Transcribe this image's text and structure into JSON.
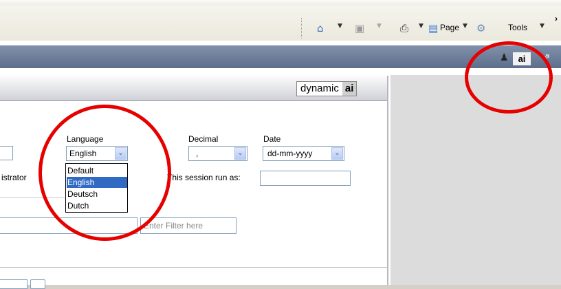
{
  "toolbar": {
    "page_label": "Page",
    "tools_label": "Tools",
    "home_icon": "home-icon",
    "feeds_icon": "feeds-icon",
    "print_icon": "print-icon",
    "page_icon": "page-icon",
    "tools_icon": "gear-icon"
  },
  "appbar": {
    "user_icon": "user-icon",
    "ai_badge": "ai",
    "collapse_icon": "collapse-icon"
  },
  "panel": {
    "logo_text": "dynamic",
    "logo_ai": "ai"
  },
  "form": {
    "language_label": "Language",
    "language_value": "English",
    "language_options": [
      "Default",
      "English",
      "Deutsch",
      "Dutch"
    ],
    "language_selected_index": 1,
    "decimal_label": "Decimal",
    "decimal_value": ",",
    "date_label": "Date",
    "date_value": "dd-mm-yyyy",
    "user_partial": "istrator",
    "session_label": "This session run as:",
    "session_value": "",
    "filter_placeholder": "Enter Filter here"
  },
  "colors": {
    "annotation": "#e60000",
    "appbar": "#6b7b98",
    "selected_option": "#316ac5"
  }
}
